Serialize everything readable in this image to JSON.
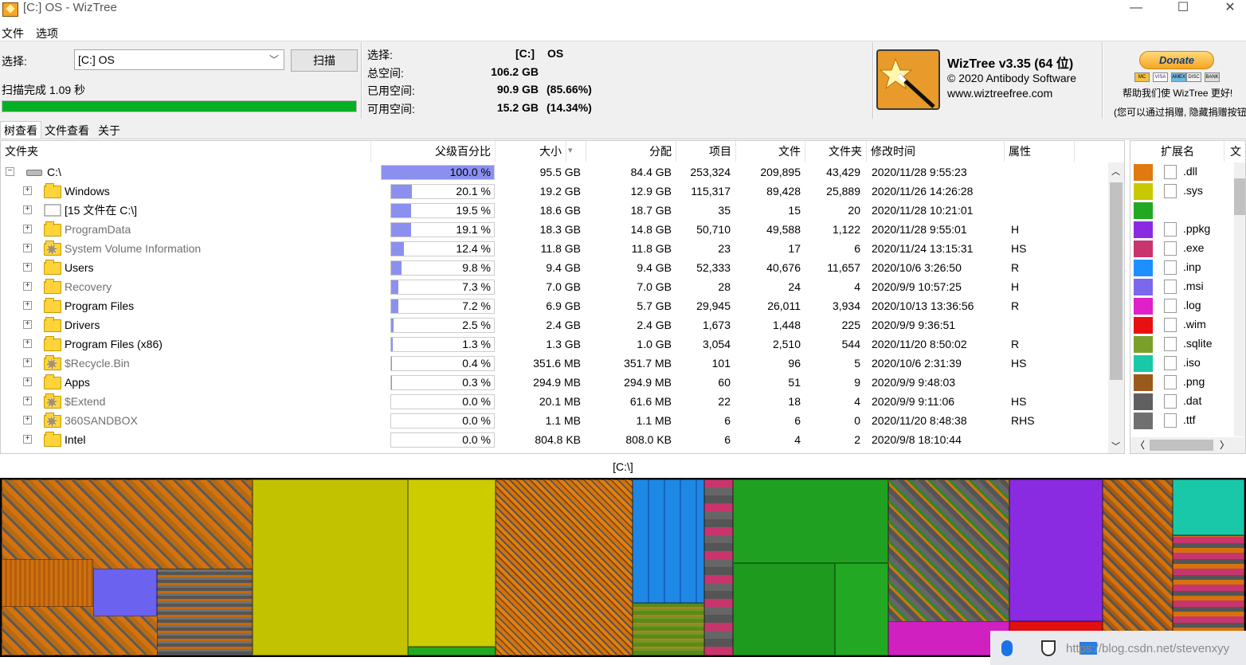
{
  "window": {
    "title": "[C:] OS  - WizTree",
    "minimize": "—",
    "maximize": "☐",
    "close": "✕"
  },
  "menu": {
    "file": "文件",
    "options": "选项"
  },
  "scan": {
    "select_label": "选择:",
    "drive_value": "[C:] OS",
    "scan_button": "扫描",
    "status": "扫描完成 1.09 秒",
    "progress": 1.0
  },
  "stats": {
    "select_label": "选择:",
    "drive": "[C:]",
    "drive_name": "OS",
    "total_label": "总空间:",
    "total": "106.2 GB",
    "used_label": "已用空间:",
    "used": "90.9 GB",
    "used_pct": "(85.66%)",
    "free_label": "可用空间:",
    "free": "15.2 GB",
    "free_pct": "(14.34%)"
  },
  "about": {
    "name": "WizTree v3.35 (64 位)",
    "copyright": "© 2020 Antibody Software",
    "url": "www.wiztreefree.com"
  },
  "donate": {
    "button": "Donate",
    "help_text": "帮助我们使 WizTree 更好!",
    "footnote": "(您可以通过捐赠, 隐藏捐赠按钮",
    "cards": [
      "MC",
      "VISA",
      "AMEX",
      "DISC",
      "BANK"
    ]
  },
  "tabs": [
    "树查看",
    "文件查看",
    "关于"
  ],
  "columns": [
    "文件夹",
    "父级百分比",
    "大小",
    "分配",
    "项目",
    "文件",
    "文件夹",
    "修改时间",
    "属性"
  ],
  "sort_indicator": "▾",
  "rows": [
    {
      "name": "C:\\",
      "icon": "drive-icon",
      "pct": "100.0 %",
      "pct_value": 100.0,
      "size": "95.5 GB",
      "alloc": "84.4 GB",
      "items": "253,324",
      "files": "209,895",
      "folders": "43,429",
      "modified": "2020/11/28 9:55:23",
      "attr": ""
    },
    {
      "name": "Windows",
      "icon": "folder-icon",
      "pct": "20.1 %",
      "pct_value": 20.1,
      "size": "19.2 GB",
      "alloc": "12.9 GB",
      "items": "115,317",
      "files": "89,428",
      "folders": "25,889",
      "modified": "2020/11/26 14:26:28",
      "attr": ""
    },
    {
      "name": "[15 文件在 C:\\]",
      "icon": "files-icon",
      "pct": "19.5 %",
      "pct_value": 19.5,
      "size": "18.6 GB",
      "alloc": "18.7 GB",
      "items": "35",
      "files": "15",
      "folders": "20",
      "modified": "2020/11/28 10:21:01",
      "attr": ""
    },
    {
      "name": "ProgramData",
      "icon": "folder-icon",
      "gray": true,
      "pct": "19.1 %",
      "pct_value": 19.1,
      "size": "18.3 GB",
      "alloc": "14.8 GB",
      "items": "50,710",
      "files": "49,588",
      "folders": "1,122",
      "modified": "2020/11/28 9:55:01",
      "attr": "H"
    },
    {
      "name": "System Volume Information",
      "icon": "system-folder-icon",
      "gray": true,
      "pct": "12.4 %",
      "pct_value": 12.4,
      "size": "11.8 GB",
      "alloc": "11.8 GB",
      "items": "23",
      "files": "17",
      "folders": "6",
      "modified": "2020/11/24 13:15:31",
      "attr": "HS"
    },
    {
      "name": "Users",
      "icon": "folder-icon",
      "pct": "9.8 %",
      "pct_value": 9.8,
      "size": "9.4 GB",
      "alloc": "9.4 GB",
      "items": "52,333",
      "files": "40,676",
      "folders": "11,657",
      "modified": "2020/10/6 3:26:50",
      "attr": "R"
    },
    {
      "name": "Recovery",
      "icon": "folder-icon",
      "gray": true,
      "pct": "7.3 %",
      "pct_value": 7.3,
      "size": "7.0 GB",
      "alloc": "7.0 GB",
      "items": "28",
      "files": "24",
      "folders": "4",
      "modified": "2020/9/9 10:57:25",
      "attr": "H"
    },
    {
      "name": "Program Files",
      "icon": "folder-icon",
      "pct": "7.2 %",
      "pct_value": 7.2,
      "size": "6.9 GB",
      "alloc": "5.7 GB",
      "items": "29,945",
      "files": "26,011",
      "folders": "3,934",
      "modified": "2020/10/13 13:36:56",
      "attr": "R"
    },
    {
      "name": "Drivers",
      "icon": "folder-icon",
      "pct": "2.5 %",
      "pct_value": 2.5,
      "size": "2.4 GB",
      "alloc": "2.4 GB",
      "items": "1,673",
      "files": "1,448",
      "folders": "225",
      "modified": "2020/9/9 9:36:51",
      "attr": ""
    },
    {
      "name": "Program Files (x86)",
      "icon": "folder-icon",
      "pct": "1.3 %",
      "pct_value": 1.3,
      "size": "1.3 GB",
      "alloc": "1.0 GB",
      "items": "3,054",
      "files": "2,510",
      "folders": "544",
      "modified": "2020/11/20 8:50:02",
      "attr": "R"
    },
    {
      "name": "$Recycle.Bin",
      "icon": "system-folder-icon",
      "gray": true,
      "pct": "0.4 %",
      "pct_value": 0.4,
      "size": "351.6 MB",
      "alloc": "351.7 MB",
      "items": "101",
      "files": "96",
      "folders": "5",
      "modified": "2020/10/6 2:31:39",
      "attr": "HS"
    },
    {
      "name": "Apps",
      "icon": "folder-icon",
      "pct": "0.3 %",
      "pct_value": 0.3,
      "size": "294.9 MB",
      "alloc": "294.9 MB",
      "items": "60",
      "files": "51",
      "folders": "9",
      "modified": "2020/9/9 9:48:03",
      "attr": ""
    },
    {
      "name": "$Extend",
      "icon": "system-folder-icon",
      "gray": true,
      "pct": "0.0 %",
      "pct_value": 0.0,
      "size": "20.1 MB",
      "alloc": "61.6 MB",
      "items": "22",
      "files": "18",
      "folders": "4",
      "modified": "2020/9/9 9:11:06",
      "attr": "HS"
    },
    {
      "name": "360SANDBOX",
      "icon": "system-folder-icon",
      "gray": true,
      "pct": "0.0 %",
      "pct_value": 0.0,
      "size": "1.1 MB",
      "alloc": "1.1 MB",
      "items": "6",
      "files": "6",
      "folders": "0",
      "modified": "2020/11/20 8:48:38",
      "attr": "RHS"
    },
    {
      "name": "Intel",
      "icon": "folder-icon",
      "pct": "0.0 %",
      "pct_value": 0.0,
      "size": "804.8 KB",
      "alloc": "808.0 KB",
      "items": "6",
      "files": "4",
      "folders": "2",
      "modified": "2020/9/8 18:10:44",
      "attr": ""
    }
  ],
  "ext_columns": [
    "扩展名",
    "文"
  ],
  "extensions": [
    {
      "ext": ".dll",
      "color": "#e07a10"
    },
    {
      "ext": ".sys",
      "color": "#c8c800"
    },
    {
      "ext": "",
      "color": "#22a822"
    },
    {
      "ext": ".ppkg",
      "color": "#8a2be2"
    },
    {
      "ext": ".exe",
      "color": "#c8356e"
    },
    {
      "ext": ".inp",
      "color": "#1e8fff"
    },
    {
      "ext": ".msi",
      "color": "#7b68ee"
    },
    {
      "ext": ".log",
      "color": "#e020c8"
    },
    {
      "ext": ".wim",
      "color": "#e81010"
    },
    {
      "ext": ".sqlite",
      "color": "#7ba02a"
    },
    {
      "ext": ".iso",
      "color": "#18c8a8"
    },
    {
      "ext": ".png",
      "color": "#9a5a1a"
    },
    {
      "ext": ".dat",
      "color": "#606060"
    },
    {
      "ext": ".ttf",
      "color": "#707070"
    }
  ],
  "treemap": {
    "label": "[C:\\]"
  },
  "watermark": "https://blog.csdn.net/stevenxyy"
}
